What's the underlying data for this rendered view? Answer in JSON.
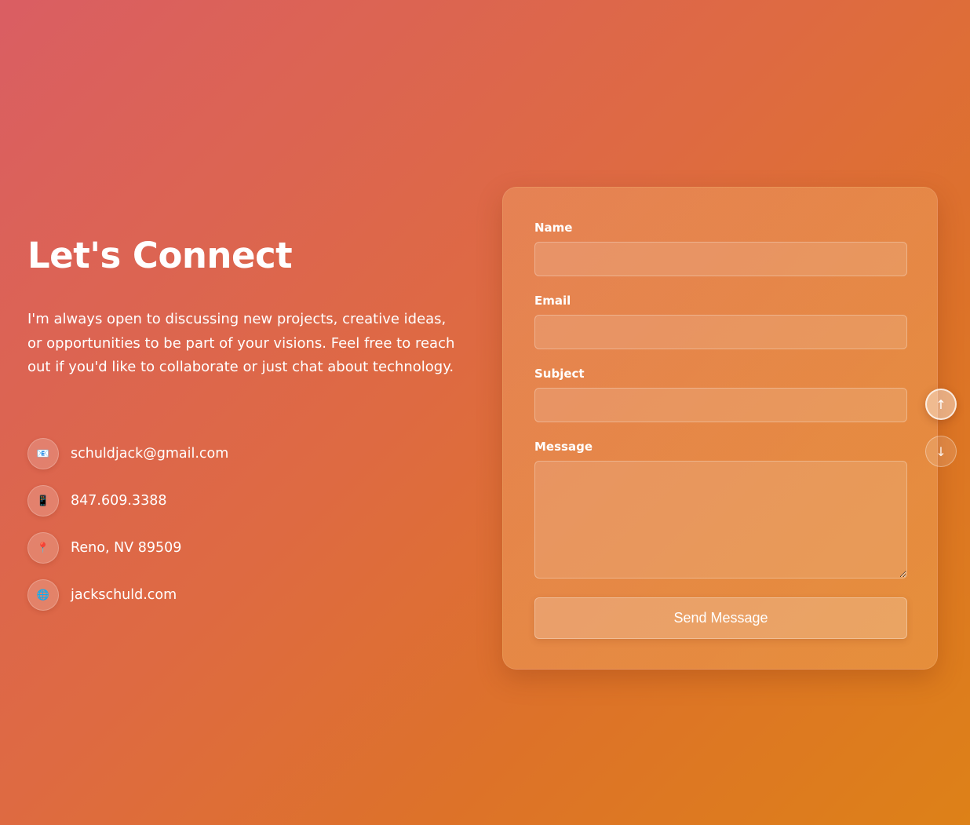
{
  "hero": {
    "title": "Let's Connect",
    "intro": "I'm always open to discussing new projects, creative ideas, or opportunities to be part of your visions. Feel free to reach out if you'd like to collaborate or just chat about technology."
  },
  "contacts": [
    {
      "icon": "envelope-icon",
      "glyph": "📧",
      "text": "schuldjack@gmail.com"
    },
    {
      "icon": "phone-icon",
      "glyph": "📱",
      "text": "847.609.3388"
    },
    {
      "icon": "location-pin-icon",
      "glyph": "📍",
      "text": "Reno, NV 89509"
    },
    {
      "icon": "globe-icon",
      "glyph": "🌐",
      "text": "jackschuld.com"
    }
  ],
  "form": {
    "name_label": "Name",
    "name_value": "",
    "email_label": "Email",
    "email_value": "",
    "subject_label": "Subject",
    "subject_value": "",
    "message_label": "Message",
    "message_value": "",
    "submit_label": "Send Message"
  },
  "scroll": {
    "up_glyph": "↑",
    "down_glyph": "↓"
  },
  "colors": {
    "gradient_start": "#da5e63",
    "gradient_end": "#dd8118",
    "text": "#ffffff"
  }
}
